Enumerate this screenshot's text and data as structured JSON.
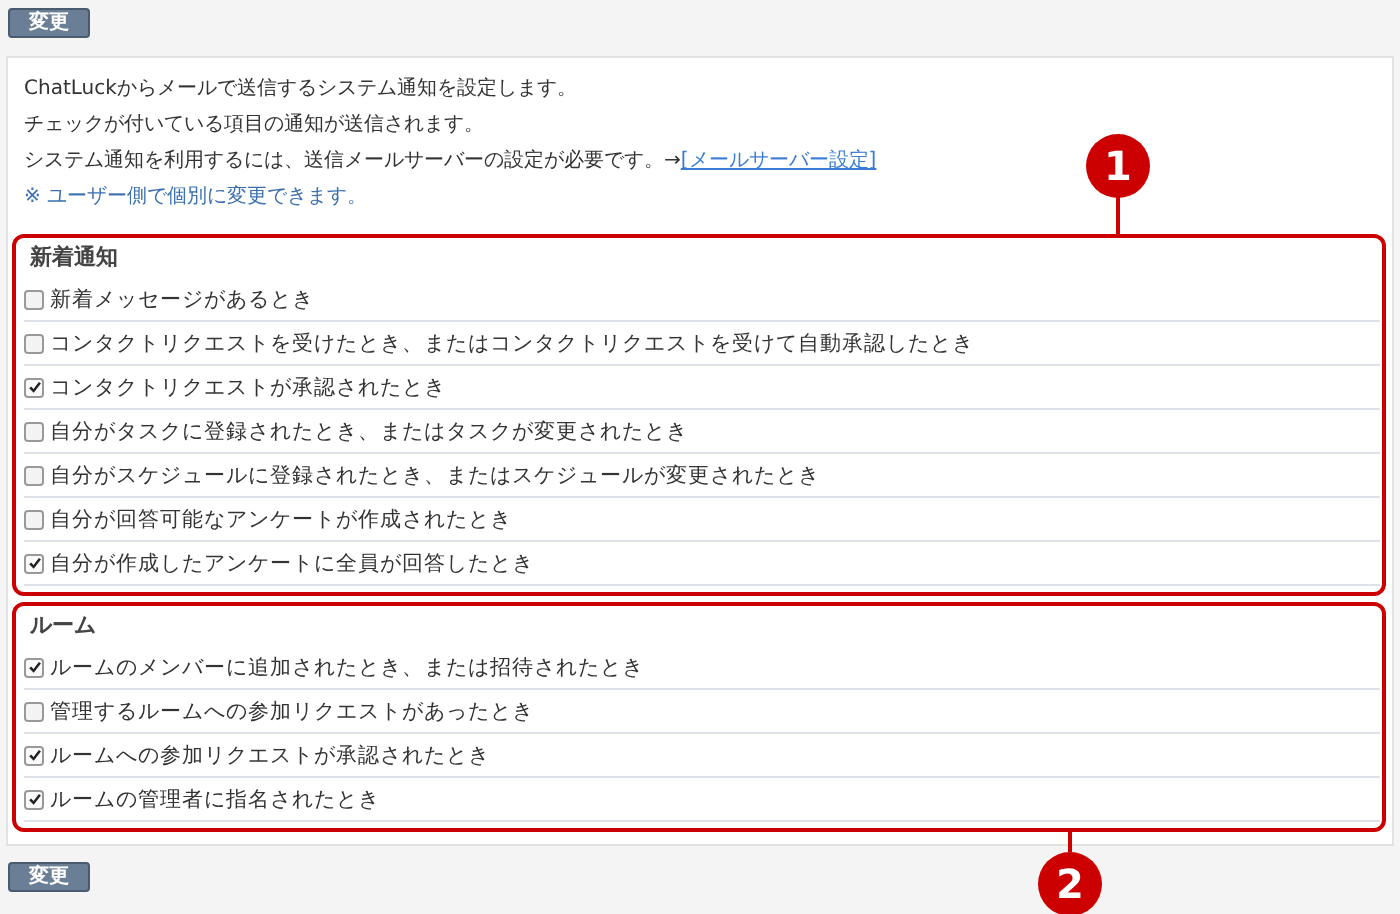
{
  "top_button": {
    "label": "変更"
  },
  "intro": [
    {
      "text": "ChatLuckからメールで送信するシステム通知を設定します。"
    },
    {
      "text": "チェックが付いている項目の通知が送信されます。"
    },
    {
      "text": "システム通知を利用するには、送信メールサーバーの設定が必要です。→",
      "link": "[メールサーバー設定]"
    }
  ],
  "note": "※ ユーザー側で個別に変更できます。",
  "sections": [
    {
      "title": "新着通知",
      "callout": "1",
      "callout_below": false,
      "items": [
        {
          "label": "新着メッセージがあるとき",
          "checked": false
        },
        {
          "label": "コンタクトリクエストを受けたとき、またはコンタクトリクエストを受けて自動承認したとき",
          "checked": false
        },
        {
          "label": "コンタクトリクエストが承認されたとき",
          "checked": true
        },
        {
          "label": "自分がタスクに登録されたとき、またはタスクが変更されたとき",
          "checked": false
        },
        {
          "label": "自分がスケジュールに登録されたとき、またはスケジュールが変更されたとき",
          "checked": false
        },
        {
          "label": "自分が回答可能なアンケートが作成されたとき",
          "checked": false
        },
        {
          "label": "自分が作成したアンケートに全員が回答したとき",
          "checked": true
        }
      ]
    },
    {
      "title": "ルーム",
      "callout": "2",
      "callout_below": true,
      "items": [
        {
          "label": "ルームのメンバーに追加されたとき、または招待されたとき",
          "checked": true
        },
        {
          "label": "管理するルームへの参加リクエストがあったとき",
          "checked": false
        },
        {
          "label": "ルームへの参加リクエストが承認されたとき",
          "checked": true
        },
        {
          "label": "ルームの管理者に指名されたとき",
          "checked": true
        }
      ]
    }
  ],
  "bottom_button": {
    "label": "変更"
  }
}
